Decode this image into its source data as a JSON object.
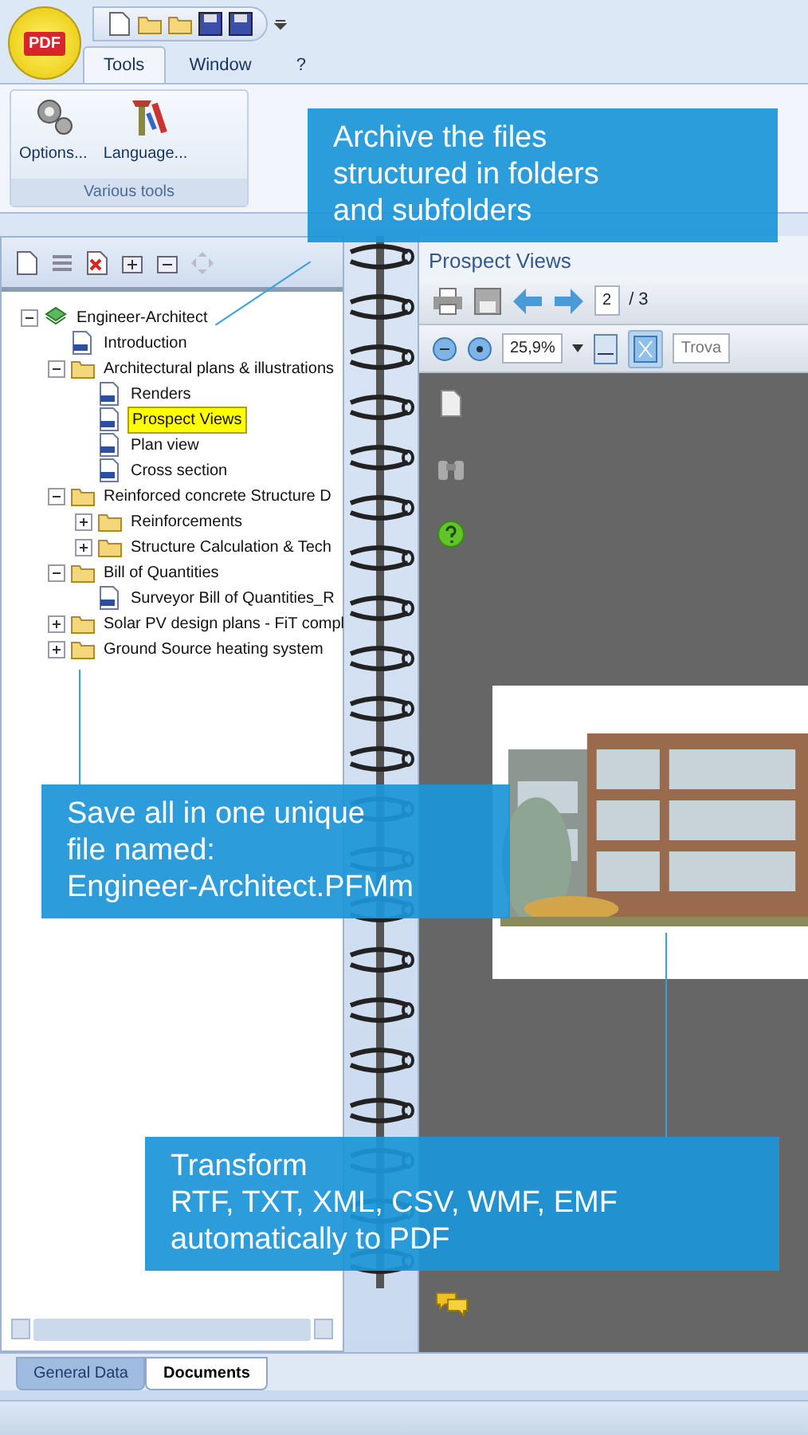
{
  "app": {
    "logo": "PDF"
  },
  "ribbon": {
    "tabs": [
      {
        "label": "Tools",
        "selected": true
      },
      {
        "label": "Window",
        "selected": false
      },
      {
        "label": "?",
        "selected": false
      }
    ],
    "group": {
      "label": "Various tools",
      "buttons": [
        {
          "label": "Options...",
          "kind": "gear"
        },
        {
          "label": "Language...",
          "kind": "tools"
        }
      ]
    }
  },
  "tree": [
    {
      "label": "Engineer-Architect",
      "kind": "root",
      "expanded": true,
      "selected": false,
      "children": [
        {
          "label": "Introduction",
          "kind": "pdf",
          "selected": false
        },
        {
          "label": "Architectural plans & illustrations",
          "kind": "folder",
          "expanded": true,
          "selected": false,
          "children": [
            {
              "label": "Renders",
              "kind": "pdf",
              "selected": false
            },
            {
              "label": "Prospect Views",
              "kind": "pdf",
              "selected": true
            },
            {
              "label": "Plan view",
              "kind": "pdf",
              "selected": false
            },
            {
              "label": "Cross section",
              "kind": "pdf",
              "selected": false
            }
          ]
        },
        {
          "label": "Reinforced concrete Structure D",
          "kind": "folder",
          "expanded": true,
          "selected": false,
          "children": [
            {
              "label": "Reinforcements",
              "kind": "folder",
              "expanded": false,
              "selected": false
            },
            {
              "label": "Structure Calculation & Tech",
              "kind": "folder",
              "expanded": false,
              "selected": false
            }
          ]
        },
        {
          "label": "Bill of Quantities",
          "kind": "folder",
          "expanded": true,
          "selected": false,
          "children": [
            {
              "label": "Surveyor Bill of Quantities_R",
              "kind": "pdf",
              "selected": false
            }
          ]
        },
        {
          "label": "Solar PV design plans - FiT compl",
          "kind": "folder",
          "expanded": false,
          "selected": false
        },
        {
          "label": "Ground Source heating system",
          "kind": "folder",
          "expanded": false,
          "selected": false
        }
      ]
    }
  ],
  "viewer": {
    "title": "Prospect Views",
    "page": "2",
    "page_count": "/ 3",
    "zoom": "25,9%",
    "search_placeholder": "Trova"
  },
  "bottom_tabs": [
    {
      "label": "General Data",
      "selected": false
    },
    {
      "label": "Documents",
      "selected": true
    }
  ],
  "callouts": [
    {
      "text": "Archive the files\nstructured in folders\nand subfolders"
    },
    {
      "text": "Save all in one unique\nfile named:\nEngineer-Architect.PFMm"
    },
    {
      "text": "Transform\nRTF, TXT, XML, CSV, WMF, EMF\nautomatically to PDF"
    }
  ]
}
